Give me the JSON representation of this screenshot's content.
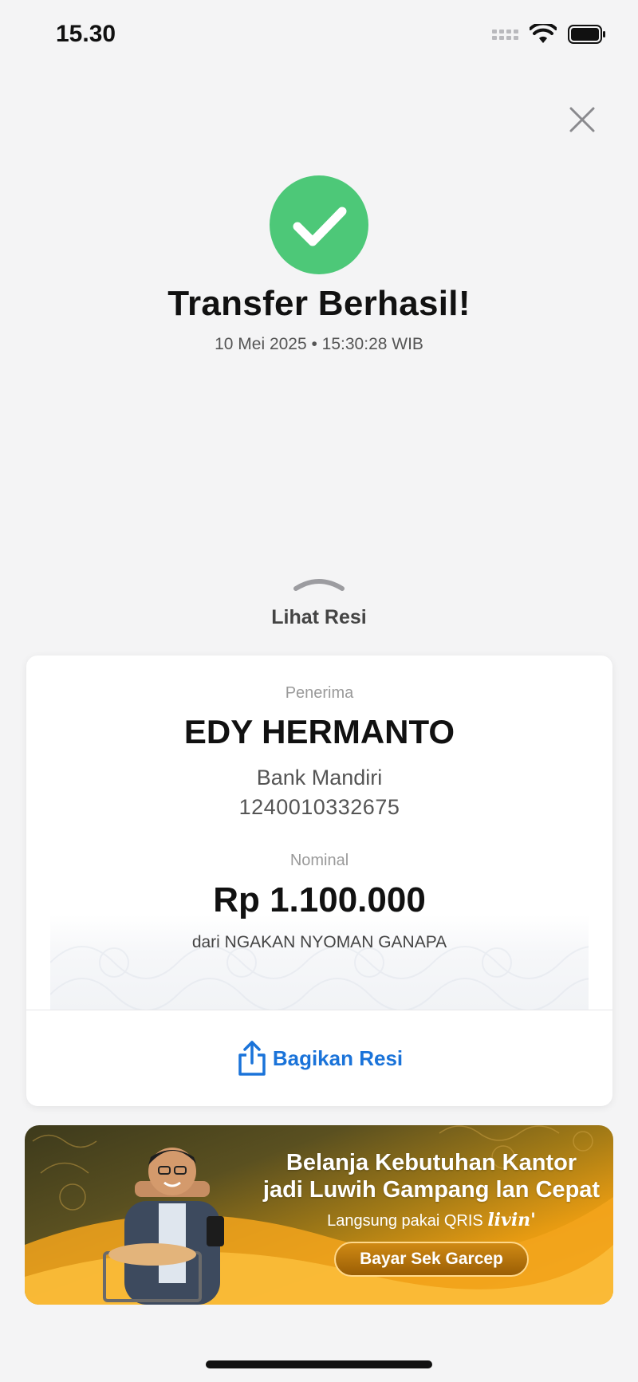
{
  "status_bar": {
    "time": "15.30"
  },
  "success": {
    "title": "Transfer Berhasil!",
    "datetime": "10 Mei 2025 • 15:30:28 WIB",
    "accent_color": "#4dc878"
  },
  "receipt_toggle": {
    "label": "Lihat Resi"
  },
  "receipt": {
    "recipient_label": "Penerima",
    "recipient_name": "EDY HERMANTO",
    "bank": "Bank Mandiri",
    "account_number": "1240010332675",
    "amount_label": "Nominal",
    "amount": "Rp 1.100.000",
    "sender": "dari NGAKAN NYOMAN GANAPA"
  },
  "share": {
    "label": "Bagikan Resi",
    "color": "#1a73d9"
  },
  "promo": {
    "headline_line1": "Belanja Kebutuhan Kantor",
    "headline_line2": "jadi Luwih Gampang lan Cepat",
    "sub_text": "Langsung pakai QRIS",
    "brand_logo": "livin'",
    "cta": "Bayar Sek Garcep"
  },
  "icons": {
    "close": "close-icon",
    "success": "check-circle-icon",
    "chevron": "chevron-up-icon",
    "share": "share-icon"
  }
}
